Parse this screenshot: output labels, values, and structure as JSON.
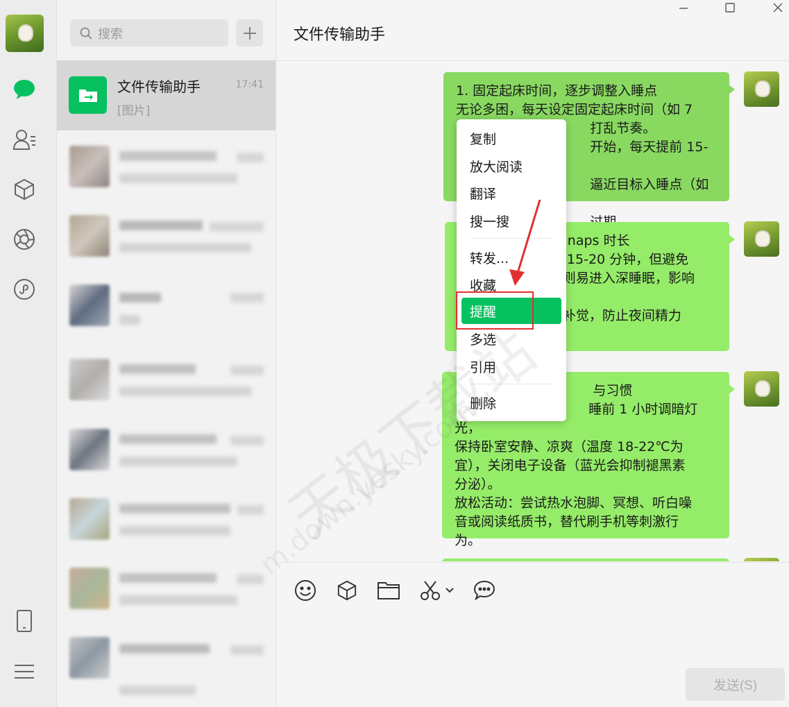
{
  "search": {
    "placeholder": "搜索"
  },
  "session": {
    "name": "文件传输助手",
    "time": "17:41",
    "preview": "[图片]"
  },
  "chat": {
    "title": "文件传输助手"
  },
  "messages": [
    {
      "text": "1. 固定起床时间，逐步调整入睡点\n无论多困，每天设定固定起床时间（如 7\n                                打乱节奏。\n                                开始，每天提前 15-30\n                                逼近目标入睡点（如 23\n                                过期。"
    },
    {
      "text": "                   控制 naps 时长\n                      睡 15-20 分钟，但避免\n                      否则易进入深睡眠，影响\n\n                      不补觉，防止夜间精力"
    },
    {
      "text": "                                 与习惯\n                                睡前 1 小时调暗灯光，\n保持卧室安静、凉爽（温度 18-22℃为\n宜），关闭电子设备（蓝光会抑制褪黑素\n分泌）。\n放松活动：尝试热水泡脚、冥想、听白噪\n音或阅读纸质书，替代刷手机等刺激行\n为。"
    }
  ],
  "menu": {
    "items": [
      "复制",
      "放大阅读",
      "翻译",
      "搜一搜",
      "转发...",
      "收藏",
      "提醒",
      "多选",
      "引用",
      "删除"
    ]
  },
  "send_label": "发送(S)",
  "watermark": {
    "text1": "天极下载站",
    "text2": "m.down.yesky.com"
  },
  "colors": {
    "accent": "#07c160",
    "bubble": "#95ec69",
    "annotation": "#e03030"
  }
}
